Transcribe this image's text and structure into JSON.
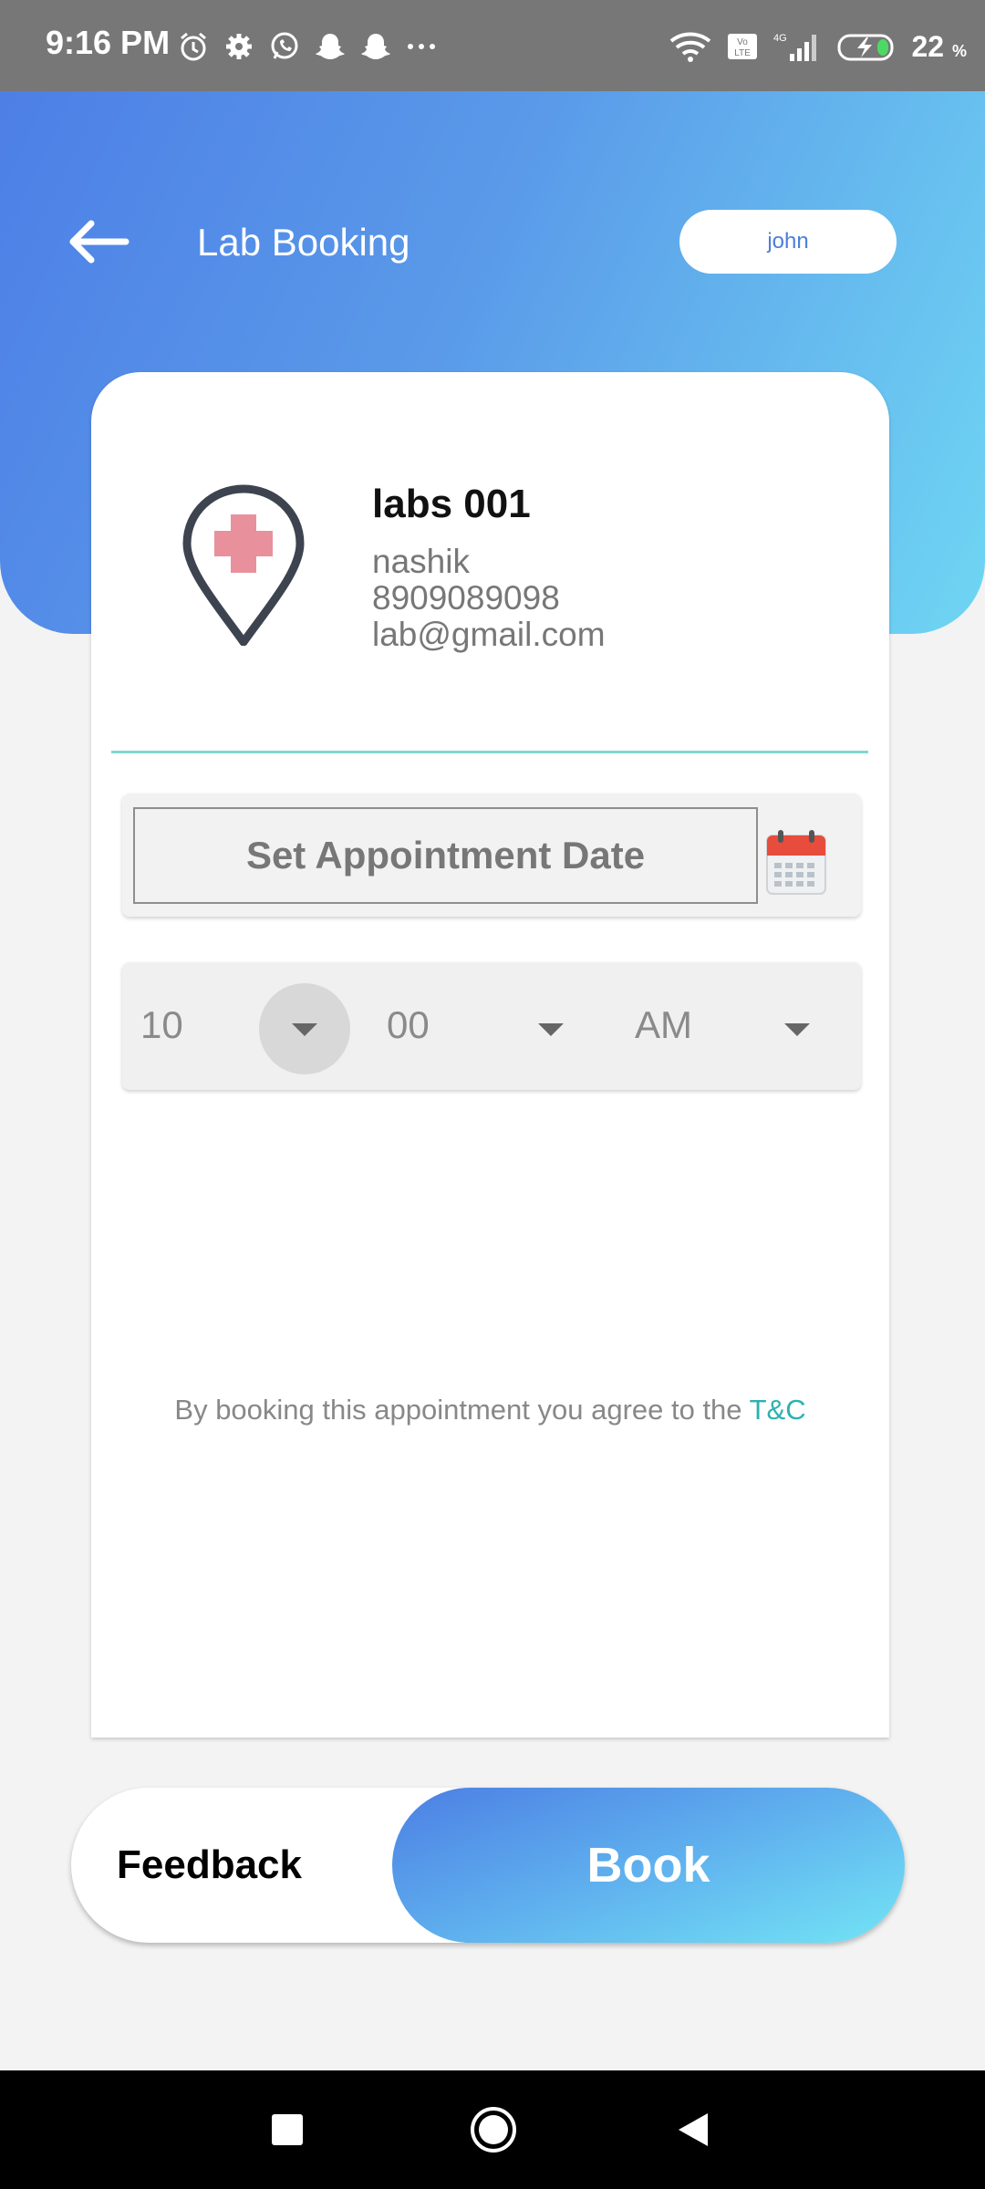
{
  "status_bar": {
    "time": "9:16 PM",
    "battery": "22",
    "battery_unit": "%",
    "left_icons": [
      "alarm-icon",
      "settings-icon",
      "whatsapp-icon",
      "snapchat-icon",
      "snapchat-icon",
      "more-dots-icon"
    ],
    "right_icons": [
      "wifi-icon",
      "volte-icon",
      "signal-4g-icon",
      "battery-charging-icon"
    ]
  },
  "header": {
    "title": "Lab Booking",
    "user": "john"
  },
  "lab": {
    "name": "labs 001",
    "city": "nashik",
    "phone": "8909089098",
    "email": "lab@gmail.com"
  },
  "appointment": {
    "date_placeholder": "Set Appointment Date",
    "hour": "10",
    "minute": "00",
    "period": "AM"
  },
  "terms": {
    "text": "By booking this appointment you agree to the ",
    "link": "T&C"
  },
  "actions": {
    "feedback": "Feedback",
    "book": "Book"
  },
  "colors": {
    "header_gradient_start": "#4d7fe6",
    "header_gradient_end": "#6fd6f3",
    "accent_teal": "#2cb2b0",
    "lab_icon_cross": "#e8919c",
    "calendar_red": "#e74c3c"
  }
}
